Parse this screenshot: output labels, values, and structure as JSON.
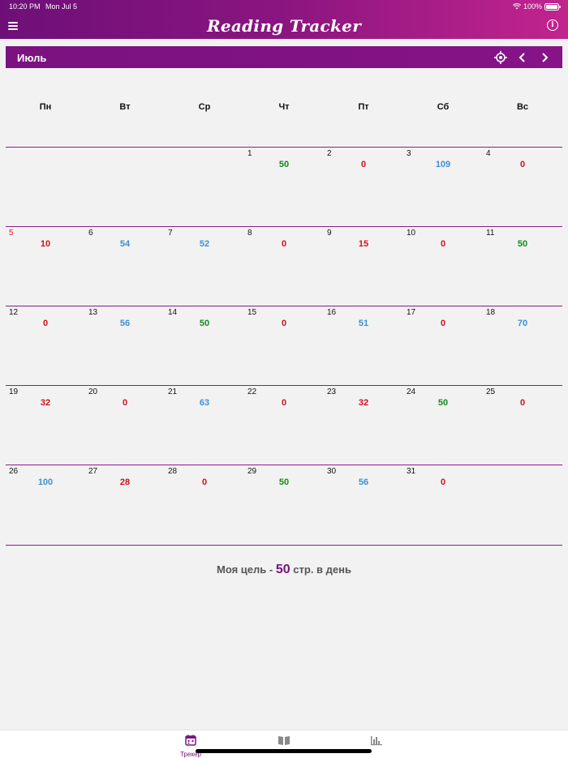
{
  "status_bar": {
    "time": "10:20 PM",
    "date": "Mon Jul 5",
    "battery": "100%"
  },
  "header": {
    "title": "Reading Tracker",
    "menu_icon": "hamburger-icon",
    "info_icon": "info-icon"
  },
  "month_bar": {
    "month": "Июль",
    "locate_icon": "locate-icon",
    "prev_icon": "chevron-left-icon",
    "next_icon": "chevron-right-icon"
  },
  "weekdays": [
    "Пн",
    "Вт",
    "Ср",
    "Чт",
    "Пт",
    "Сб",
    "Вс"
  ],
  "calendar": {
    "weeks": [
      [
        null,
        null,
        null,
        {
          "day": "1",
          "pages": "50",
          "status": "goal"
        },
        {
          "day": "2",
          "pages": "0",
          "status": "below"
        },
        {
          "day": "3",
          "pages": "109",
          "status": "above"
        },
        {
          "day": "4",
          "pages": "0",
          "status": "below"
        }
      ],
      [
        {
          "day": "5",
          "pages": "10",
          "status": "below",
          "sunday": true
        },
        {
          "day": "6",
          "pages": "54",
          "status": "above"
        },
        {
          "day": "7",
          "pages": "52",
          "status": "above"
        },
        {
          "day": "8",
          "pages": "0",
          "status": "below"
        },
        {
          "day": "9",
          "pages": "15",
          "status": "below"
        },
        {
          "day": "10",
          "pages": "0",
          "status": "below"
        },
        {
          "day": "11",
          "pages": "50",
          "status": "goal"
        }
      ],
      [
        {
          "day": "12",
          "pages": "0",
          "status": "below"
        },
        {
          "day": "13",
          "pages": "56",
          "status": "above"
        },
        {
          "day": "14",
          "pages": "50",
          "status": "goal"
        },
        {
          "day": "15",
          "pages": "0",
          "status": "below"
        },
        {
          "day": "16",
          "pages": "51",
          "status": "above"
        },
        {
          "day": "17",
          "pages": "0",
          "status": "below"
        },
        {
          "day": "18",
          "pages": "70",
          "status": "above"
        }
      ],
      [
        {
          "day": "19",
          "pages": "32",
          "status": "below"
        },
        {
          "day": "20",
          "pages": "0",
          "status": "below"
        },
        {
          "day": "21",
          "pages": "63",
          "status": "above"
        },
        {
          "day": "22",
          "pages": "0",
          "status": "below"
        },
        {
          "day": "23",
          "pages": "32",
          "status": "below"
        },
        {
          "day": "24",
          "pages": "50",
          "status": "goal"
        },
        {
          "day": "25",
          "pages": "0",
          "status": "below"
        }
      ],
      [
        {
          "day": "26",
          "pages": "100",
          "status": "above"
        },
        {
          "day": "27",
          "pages": "28",
          "status": "below"
        },
        {
          "day": "28",
          "pages": "0",
          "status": "below"
        },
        {
          "day": "29",
          "pages": "50",
          "status": "goal"
        },
        {
          "day": "30",
          "pages": "56",
          "status": "above"
        },
        {
          "day": "31",
          "pages": "0",
          "status": "below"
        },
        null
      ]
    ],
    "status_colors": {
      "goal": "#138a1e",
      "below": "#d0101a",
      "above": "#3d8fd6"
    }
  },
  "goal": {
    "prefix": "Моя цель -",
    "value": "50",
    "suffix": "стр. в день"
  },
  "tabbar": {
    "tabs": [
      {
        "label": "Трекер",
        "icon": "calendar-icon",
        "active": true
      },
      {
        "label": "",
        "icon": "book-icon",
        "active": false
      },
      {
        "label": "",
        "icon": "bar-chart-icon",
        "active": false
      }
    ]
  },
  "colors": {
    "brand": "#7a1280",
    "accent": "#c2248e"
  }
}
